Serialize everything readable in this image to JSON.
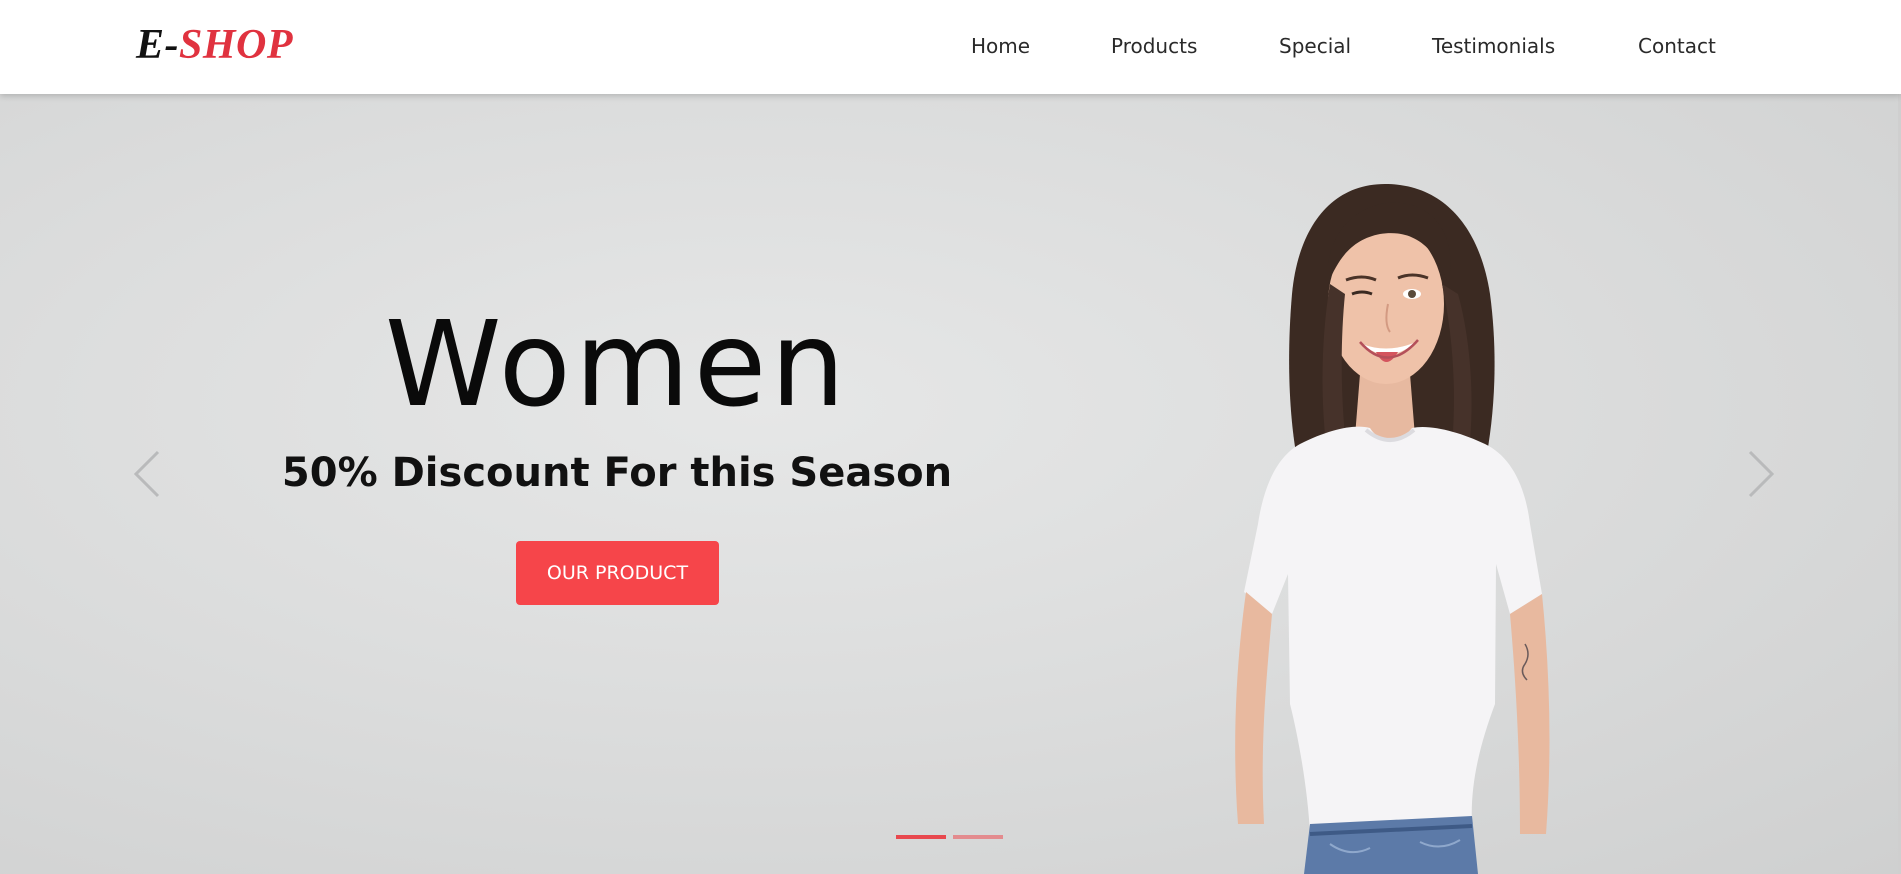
{
  "header": {
    "logo": {
      "prefix": "E",
      "separator": "-",
      "brand": "SHOP"
    },
    "nav": [
      {
        "label": "Home"
      },
      {
        "label": "Products"
      },
      {
        "label": "Special"
      },
      {
        "label": "Testimonials"
      },
      {
        "label": "Contact"
      }
    ]
  },
  "hero": {
    "title": "Women",
    "subtitle": "50% Discount For this Season",
    "cta_label": "OUR PRODUCT",
    "prev_icon": "chevron-left-icon",
    "next_icon": "chevron-right-icon",
    "slides_total": 2,
    "active_slide": 1
  },
  "colors": {
    "accent": "#f6454a",
    "brand": "#e0323f",
    "hero_bg": "#dcdddd",
    "indicator_active": "#e8484e",
    "indicator_inactive": "#e38b8e"
  }
}
